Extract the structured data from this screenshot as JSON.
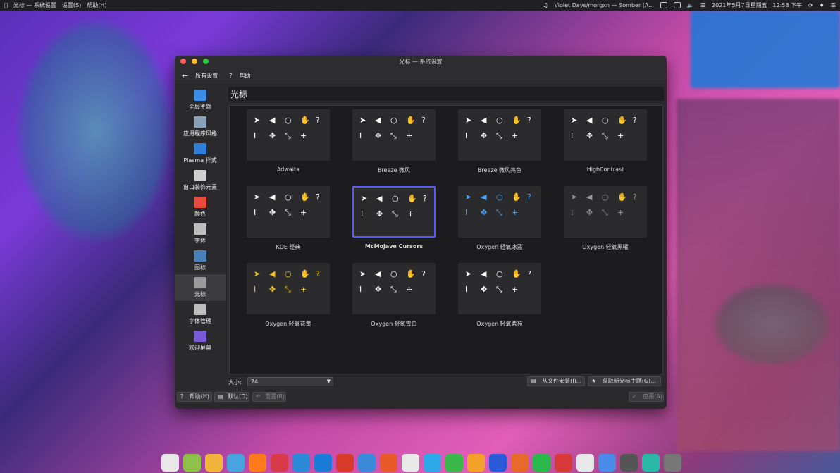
{
  "menubar": {
    "items": [
      "光标 — 系统设置",
      "设置(S)",
      "帮助(H)"
    ],
    "now_playing": "Violet Days/morgxn — Somber (A...",
    "clock": "2021年5月7日星期五 | 12:58 下午"
  },
  "window": {
    "title": "光标 — 系统设置",
    "nav": {
      "back_label": "所有设置",
      "help_label": "帮助"
    },
    "sidebar": [
      {
        "label": "全局主题",
        "color": "#3a8ee6"
      },
      {
        "label": "应用程序风格",
        "color": "#8aa0b8"
      },
      {
        "label": "Plasma 样式",
        "color": "#2f7fd8"
      },
      {
        "label": "窗口装饰元素",
        "color": "#cfcfcf"
      },
      {
        "label": "颜色",
        "color": "#e84c3d"
      },
      {
        "label": "字体",
        "color": "#bdbdbd"
      },
      {
        "label": "图标",
        "color": "#4a7fb8"
      },
      {
        "label": "光标",
        "color": "#9a9a9a",
        "active": true
      },
      {
        "label": "字体管理",
        "color": "#bdbdbd"
      },
      {
        "label": "欢迎屏幕",
        "color": "#7a5ad8"
      }
    ],
    "page_title": "光标",
    "themes": [
      {
        "name": "Adwaita",
        "style": "light"
      },
      {
        "name": "Breeze 微风",
        "style": "dark"
      },
      {
        "name": "Breeze 微风亮色",
        "style": "light"
      },
      {
        "name": "HighContrast",
        "style": "light"
      },
      {
        "name": "KDE 经典",
        "style": "light"
      },
      {
        "name": "McMojave Cursors",
        "style": "dark",
        "selected": true
      },
      {
        "name": "Oxygen 轻氧冰蓝",
        "style": "blue"
      },
      {
        "name": "Oxygen 轻氧黑曜",
        "style": "black"
      },
      {
        "name": "Oxygen 轻氧花黄",
        "style": "yellow"
      },
      {
        "name": "Oxygen 轻氧雪白",
        "style": "light"
      },
      {
        "name": "Oxygen 轻氧紫苑",
        "style": "light"
      }
    ],
    "size_label": "大小:",
    "size_value": "24",
    "install_file_label": "从文件安装(I)...",
    "get_new_label": "获取新光标主题(G)...",
    "footer": {
      "help": "帮助(H)",
      "defaults": "默认(D)",
      "reset": "重置(R)",
      "apply": "应用(A)"
    }
  },
  "dock": {
    "colors": [
      "#e8e8e8",
      "#8fc14a",
      "#f2b33a",
      "#4aa3df",
      "#ff7a1a",
      "#d83a4a",
      "#2b8ad8",
      "#1a7ad8",
      "#d83a2a",
      "#3a8ad8",
      "#e85a2a",
      "#e8e8e8",
      "#2aa8e8",
      "#3ab84a",
      "#f2a22a",
      "#2a5ad8",
      "#e86a2a",
      "#2ab84a",
      "#d83a3a",
      "#e8e8e8",
      "#4a8ae8",
      "#555",
      "#2ab8a8",
      "#777"
    ]
  }
}
